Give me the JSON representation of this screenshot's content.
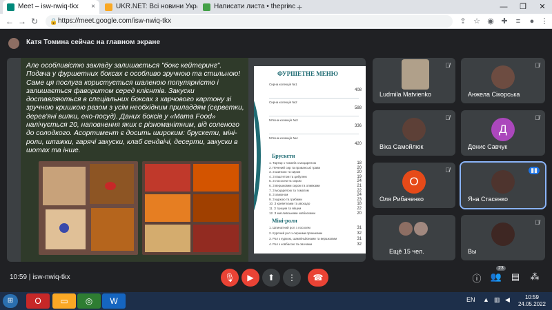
{
  "browser": {
    "tabs": [
      {
        "title": "Meet – isw-nwiq-tkx",
        "favicon": "meet-icon",
        "close": "×"
      },
      {
        "title": "UKR.NET: Всі новини України, о",
        "favicon": "ukrnet-icon",
        "close": "×"
      },
      {
        "title": "Написати листа • theprincess@",
        "favicon": "mail-icon",
        "close": "×"
      }
    ],
    "new_tab": "+",
    "window_controls": [
      "—",
      "❐",
      "✕"
    ],
    "url": "https://meet.google.com/isw-nwiq-tkx"
  },
  "meet": {
    "presenting_notice": "Катя Томина сейчас на главном экране",
    "slide": {
      "text": "Але особливістю закладу залишається \"бокс кейтеринг\". Подача у фуршетних боксах є особливо зручною та стильною! Саме ця послуга користується шаленою популярністю і залишається фаворитом серед клієнтів. Закуски доставляються в спеціальних боксах з харчового картону зі зручною кришкою разом з усім необхідним приладдям (серветки, дерев'яні вилки, еко-посуд). Даних боксів у «Mama Food» налічується 20, наповнення яких є різноманітним, від соленого до солодкого. Асортимент є досить широким: брускети, міні-роли, шпажки, гарячі закуски, клаб сендвічі, десерти, закуски в шотах та інше.",
      "menu": {
        "title": "ФУРШЕТНЕ МЕНЮ",
        "sets": [
          {
            "name": "Сирна колекція №1",
            "price": "408"
          },
          {
            "name": "Сирна колекція №2",
            "price": "588"
          },
          {
            "name": "М'ясна колекція №3",
            "price": "336"
          },
          {
            "name": "М'ясна колекція №4",
            "price": "420"
          }
        ],
        "sections": [
          {
            "title": "Брускети",
            "items": [
              {
                "name": "Тартар з томатів з моцарелою",
                "price": "18"
              },
              {
                "name": "Печений сир та прованські трави",
                "price": "20"
              },
              {
                "name": "З шинкою та сиром",
                "price": "20"
              },
              {
                "name": "З паштетом та цибулею",
                "price": "19"
              },
              {
                "name": "З лососем та сиром",
                "price": "24"
              },
              {
                "name": "З вершковим сиром та оливками",
                "price": "21"
              },
              {
                "name": "З моцарелою та томатом",
                "price": "22"
              },
              {
                "name": "З хамоном",
                "price": "24"
              },
              {
                "name": "З куркою та грибами",
                "price": "23"
              },
              {
                "name": "З креветками та авокадо",
                "price": "18"
              },
              {
                "name": "З тунцем та яйцем",
                "price": "22"
              },
              {
                "name": "З мисливськими ковбасками",
                "price": "20"
              }
            ]
          },
          {
            "title": "Міні-роли",
            "items": [
              {
                "name": "Шпинатний рол з лососем",
                "price": "31"
              },
              {
                "name": "Курячий рол з сирними пряниками",
                "price": "32"
              },
              {
                "name": "Рол з куркою, шампіньйонами та вершковим",
                "price": "31"
              },
              {
                "name": "Рол з ковбасою та овочами",
                "price": "32"
              }
            ]
          }
        ]
      }
    },
    "participants": [
      {
        "name": "Ludmila Matvienko",
        "avatar_type": "photo",
        "muted": true
      },
      {
        "name": "Анжела Сікорська",
        "avatar_type": "photo",
        "muted": true
      },
      {
        "name": "Віка Самойлюк",
        "avatar_type": "photo",
        "muted": true
      },
      {
        "name": "Денис Савчук",
        "avatar_type": "letter",
        "letter": "Д",
        "color": "#ab47bc",
        "muted": true
      },
      {
        "name": "Оля Рибаченко",
        "avatar_type": "letter",
        "letter": "О",
        "color": "#e64a19",
        "muted": true
      },
      {
        "name": "Яна Стасенко",
        "avatar_type": "photo",
        "muted": false,
        "speaking": true
      },
      {
        "name": "Ещё 15 чел.",
        "avatar_type": "group",
        "muted": false
      },
      {
        "name": "Вы",
        "avatar_type": "photo",
        "muted": true
      }
    ],
    "bottom": {
      "time": "10:59",
      "meeting_code": "isw-nwiq-tkx",
      "participant_count": "23",
      "controls": [
        "mic-off-icon",
        "camera-off-icon",
        "present-icon",
        "more-icon",
        "hangup-icon"
      ]
    }
  },
  "taskbar": {
    "apps": [
      "opera-icon",
      "folder-icon",
      "chrome-icon",
      "word-icon"
    ],
    "language": "EN",
    "time": "10:59",
    "date": "24.05.2022"
  }
}
